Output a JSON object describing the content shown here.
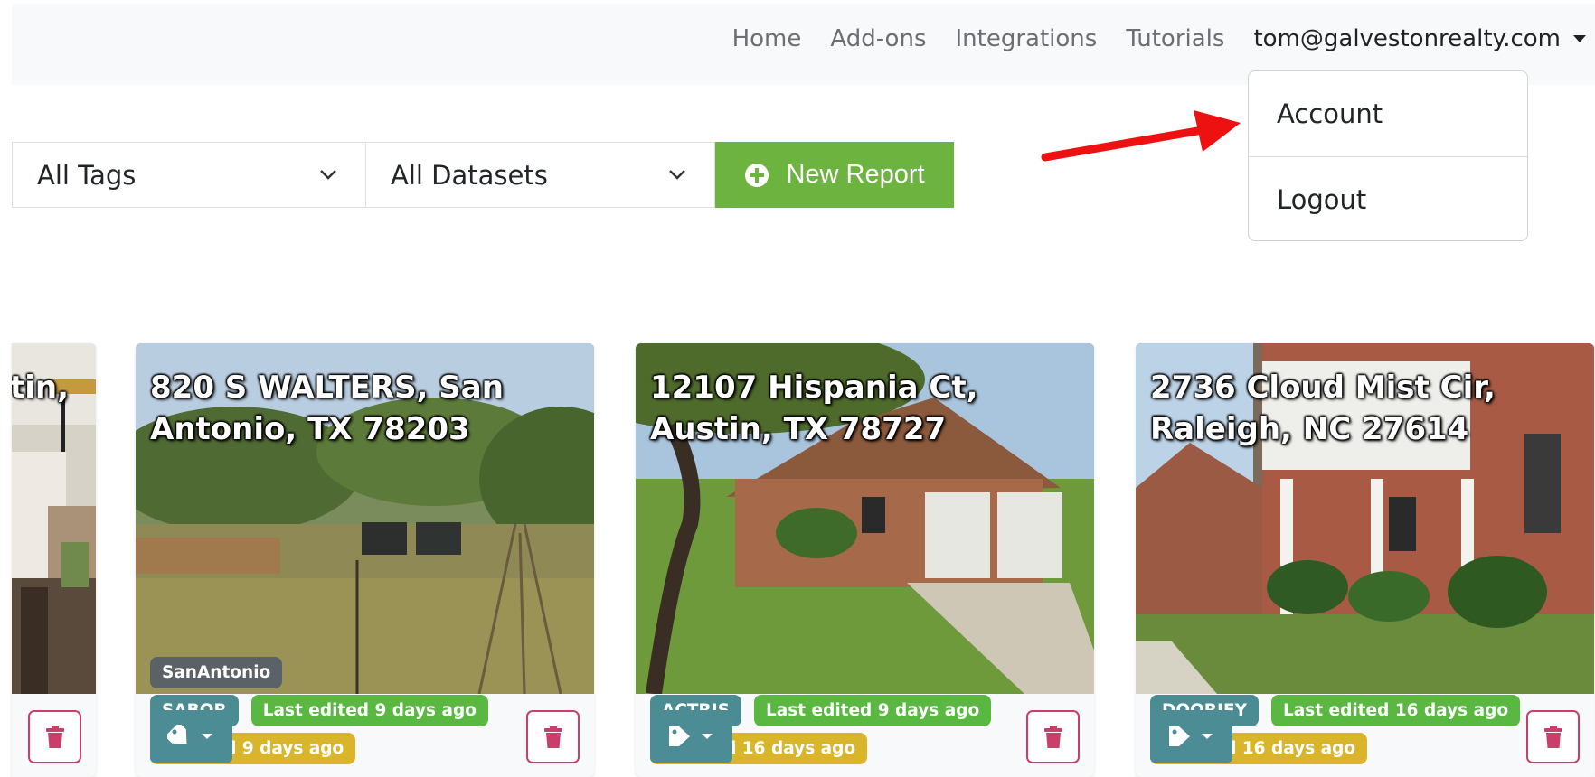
{
  "nav": {
    "links": [
      "Home",
      "Add-ons",
      "Integrations",
      "Tutorials"
    ],
    "user_email": "tom@galvestonrealty.com"
  },
  "dropdown": {
    "items": [
      "Account",
      "Logout"
    ]
  },
  "filters": {
    "tags_label": "All Tags",
    "datasets_label": "All Datasets",
    "new_report_label": "New Report"
  },
  "partial_card": {
    "title": "tin,"
  },
  "cards": [
    {
      "title": "820 S WALTERS, San Antonio, TX 78203",
      "tag": "SanAntonio",
      "source": "SABOR",
      "edited": "Last edited 9 days ago",
      "created": "Created 9 days ago"
    },
    {
      "title": "12107 Hispania Ct, Austin, TX 78727",
      "tag": "",
      "source": "ACTRIS",
      "edited": "Last edited 9 days ago",
      "created": "Created 16 days ago"
    },
    {
      "title": "2736 Cloud Mist Cir, Raleigh, NC 27614",
      "tag": "",
      "source": "DOORIFY",
      "edited": "Last edited 16 days ago",
      "created": "Created 16 days ago"
    }
  ],
  "colors": {
    "accent_green": "#6db33f",
    "tag_button": "#4c8c94",
    "delete_border": "#c93f6a",
    "annotation_arrow": "#ee1111"
  }
}
